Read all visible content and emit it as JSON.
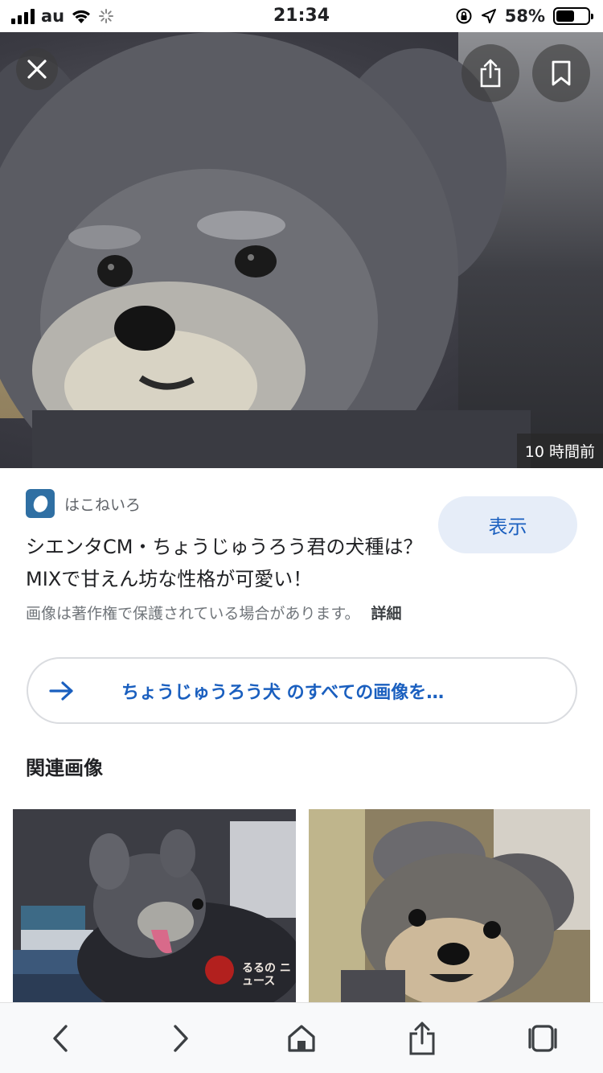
{
  "status_bar": {
    "carrier": "au",
    "time": "21:34",
    "battery_percent_text": "58%",
    "battery_level": 0.58
  },
  "hero": {
    "time_ago": "10 時間前",
    "close_icon": "close-icon",
    "share_icon": "share-icon",
    "bookmark_icon": "bookmark-icon"
  },
  "source": {
    "name": "はこねいろ",
    "logo_color": "#2f6fa3"
  },
  "visit_button": {
    "label": "表示"
  },
  "title": "シエンタCM・ちょうじゅうろう君の犬種は？MIXで甘えん坊な性格が可愛い！",
  "copyright": {
    "text": "画像は著作権で保護されている場合があります。",
    "details_label": "詳細"
  },
  "all_images": {
    "label": "ちょうじゅうろう犬 のすべての画像を…"
  },
  "related": {
    "heading": "関連画像",
    "thumb1_watermark": "るるの ニュース"
  },
  "toolbar": {
    "icons": [
      "back-icon",
      "forward-icon",
      "home-icon",
      "share-icon",
      "tabs-icon"
    ]
  },
  "colors": {
    "accent": "#1a5fbf",
    "visit_bg": "#e6edf8"
  }
}
